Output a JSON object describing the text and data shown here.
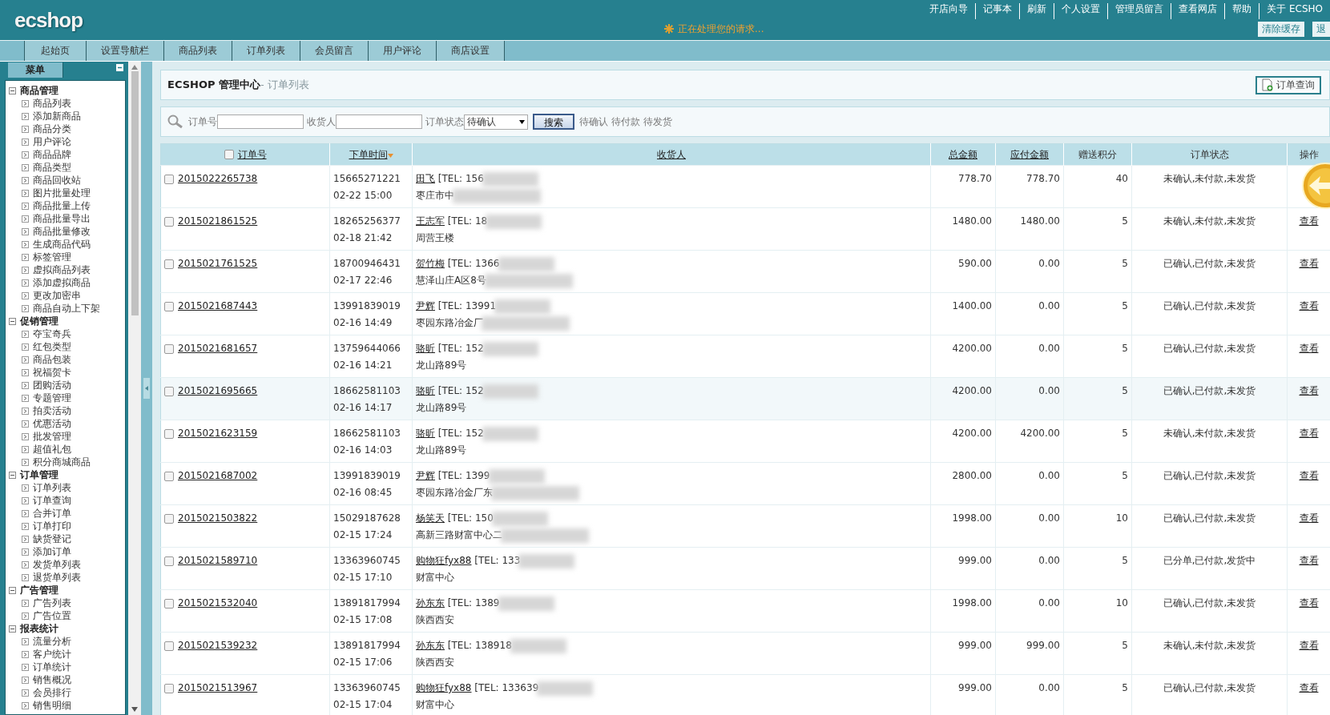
{
  "logo": "ecshop",
  "top_links": [
    "开店向导",
    "记事本",
    "刷新",
    "个人设置",
    "管理员留言",
    "查看网店",
    "帮助",
    "关于 ECSHO"
  ],
  "status_message": "正在处理您的请求...",
  "top_buttons": [
    "清除缓存",
    "退"
  ],
  "nav_tabs": [
    "起始页",
    "设置导航栏",
    "商品列表",
    "订单列表",
    "会员留言",
    "用户评论",
    "商店设置"
  ],
  "sidebar": {
    "title": "菜单",
    "groups": [
      {
        "label": "商品管理",
        "expanded": true,
        "items": [
          "商品列表",
          "添加新商品",
          "商品分类",
          "用户评论",
          "商品品牌",
          "商品类型",
          "商品回收站",
          "图片批量处理",
          "商品批量上传",
          "商品批量导出",
          "商品批量修改",
          "生成商品代码",
          "标签管理",
          "虚拟商品列表",
          "添加虚拟商品",
          "更改加密串",
          "商品自动上下架"
        ]
      },
      {
        "label": "促销管理",
        "expanded": true,
        "items": [
          "夺宝奇兵",
          "红包类型",
          "商品包装",
          "祝福贺卡",
          "团购活动",
          "专题管理",
          "拍卖活动",
          "优惠活动",
          "批发管理",
          "超值礼包",
          "积分商城商品"
        ]
      },
      {
        "label": "订单管理",
        "expanded": true,
        "items": [
          "订单列表",
          "订单查询",
          "合并订单",
          "订单打印",
          "缺货登记",
          "添加订单",
          "发货单列表",
          "退货单列表"
        ]
      },
      {
        "label": "广告管理",
        "expanded": true,
        "items": [
          "广告列表",
          "广告位置"
        ]
      },
      {
        "label": "报表统计",
        "expanded": true,
        "items": [
          "流量分析",
          "客户统计",
          "订单统计",
          "销售概况",
          "会员排行",
          "销售明细"
        ]
      }
    ]
  },
  "page_title": {
    "main": "ECSHOP 管理中心",
    "sub": "- 订单列表"
  },
  "query_button": "订单查询",
  "search": {
    "order_label": "订单号",
    "consignee_label": "收货人",
    "status_label": "订单状态",
    "status_value": "待确认",
    "button": "搜索",
    "quick_links": [
      "待确认",
      "待付款",
      "待发货"
    ]
  },
  "table": {
    "header_checked": false,
    "columns": [
      "订单号",
      "下单时间",
      "收货人",
      "总金额",
      "应付金额",
      "赠送积分",
      "订单状态",
      "操作"
    ],
    "rows": [
      {
        "order_no": "2015022265738",
        "phone": "15665271221",
        "time": "02-22 15:00",
        "name": "田飞",
        "tel": "[TEL: 156",
        "address": "枣庄市中",
        "address_blurred": true,
        "total": "778.70",
        "payable": "778.70",
        "points": "40",
        "status": "未确认,未付款,未发货",
        "checked": false,
        "highlighted": false
      },
      {
        "order_no": "2015021861525",
        "phone": "18265256377",
        "time": "02-18 21:42",
        "name": "王志军",
        "tel": "[TEL: 18",
        "address": "周营王楼",
        "address_blurred": false,
        "total": "1480.00",
        "payable": "1480.00",
        "points": "5",
        "status": "未确认,未付款,未发货",
        "action": "查看",
        "checked": false,
        "highlighted": false
      },
      {
        "order_no": "2015021761525",
        "phone": "18700946431",
        "time": "02-17 22:46",
        "name": "贺竹梅",
        "tel": "[TEL: 1366",
        "address": "慧泽山庄A区8号",
        "address_blurred": true,
        "total": "590.00",
        "payable": "0.00",
        "points": "5",
        "status": "已确认,已付款,未发货",
        "action": "查看",
        "checked": false,
        "highlighted": false
      },
      {
        "order_no": "2015021687443",
        "phone": "13991839019",
        "time": "02-16 14:49",
        "name": "尹辉",
        "tel": "[TEL: 13991",
        "address": "枣园东路冶金厂",
        "address_blurred": true,
        "total": "1400.00",
        "payable": "0.00",
        "points": "5",
        "status": "已确认,已付款,未发货",
        "action": "查看",
        "checked": false,
        "highlighted": false
      },
      {
        "order_no": "2015021681657",
        "phone": "13759644066",
        "time": "02-16 14:21",
        "name": "骆昕",
        "tel": "[TEL: 152",
        "address": "龙山路89号",
        "address_blurred": false,
        "total": "4200.00",
        "payable": "0.00",
        "points": "5",
        "status": "已确认,已付款,未发货",
        "action": "查看",
        "checked": false,
        "highlighted": false
      },
      {
        "order_no": "2015021695665",
        "phone": "18662581103",
        "time": "02-16 14:17",
        "name": "骆昕",
        "tel": "[TEL: 152",
        "address": "龙山路89号",
        "address_blurred": false,
        "total": "4200.00",
        "payable": "0.00",
        "points": "5",
        "status": "已确认,已付款,未发货",
        "action": "查看",
        "checked": false,
        "highlighted": true
      },
      {
        "order_no": "2015021623159",
        "phone": "18662581103",
        "time": "02-16 14:03",
        "name": "骆昕",
        "tel": "[TEL: 152",
        "address": "龙山路89号",
        "address_blurred": false,
        "total": "4200.00",
        "payable": "4200.00",
        "points": "5",
        "status": "未确认,未付款,未发货",
        "action": "查看",
        "checked": false,
        "highlighted": false
      },
      {
        "order_no": "2015021687002",
        "phone": "13991839019",
        "time": "02-16 08:45",
        "name": "尹辉",
        "tel": "[TEL: 1399",
        "address": "枣园东路冶金厂东",
        "address_blurred": true,
        "total": "2800.00",
        "payable": "0.00",
        "points": "5",
        "status": "已确认,已付款,未发货",
        "action": "查看",
        "checked": false,
        "highlighted": false
      },
      {
        "order_no": "2015021503822",
        "phone": "15029187628",
        "time": "02-15 17:24",
        "name": "杨笑天",
        "tel": "[TEL: 150",
        "address": "高新三路财富中心二",
        "address_blurred": true,
        "total": "1998.00",
        "payable": "0.00",
        "points": "10",
        "status": "已确认,已付款,未发货",
        "action": "查看",
        "checked": false,
        "highlighted": false
      },
      {
        "order_no": "2015021589710",
        "phone": "13363960745",
        "time": "02-15 17:10",
        "name": "购物狂fyx88",
        "tel": "[TEL: 133",
        "address": "财富中心",
        "address_blurred": false,
        "total": "999.00",
        "payable": "0.00",
        "points": "5",
        "status": "已分单,已付款,发货中",
        "action": "查看",
        "checked": false,
        "highlighted": false
      },
      {
        "order_no": "2015021532040",
        "phone": "13891817994",
        "time": "02-15 17:08",
        "name": "孙东东",
        "tel": "[TEL: 1389",
        "address": "陕西西安",
        "address_blurred": false,
        "total": "1998.00",
        "payable": "0.00",
        "points": "10",
        "status": "已确认,已付款,未发货",
        "action": "查看",
        "checked": false,
        "highlighted": false
      },
      {
        "order_no": "2015021539232",
        "phone": "13891817994",
        "time": "02-15 17:06",
        "name": "孙东东",
        "tel": "[TEL: 138918",
        "address": "陕西西安",
        "address_blurred": false,
        "total": "999.00",
        "payable": "999.00",
        "points": "5",
        "status": "未确认,未付款,未发货",
        "action": "查看",
        "checked": false,
        "highlighted": false
      },
      {
        "order_no": "2015021513967",
        "phone": "13363960745",
        "time": "02-15 17:04",
        "name": "购物狂fyx88",
        "tel": "[TEL: 133639",
        "address": "财富中心",
        "address_blurred": false,
        "total": "999.00",
        "payable": "0.00",
        "points": "5",
        "status": "已确认,已付款,未发货",
        "action": "查看",
        "checked": false,
        "highlighted": false
      }
    ]
  }
}
